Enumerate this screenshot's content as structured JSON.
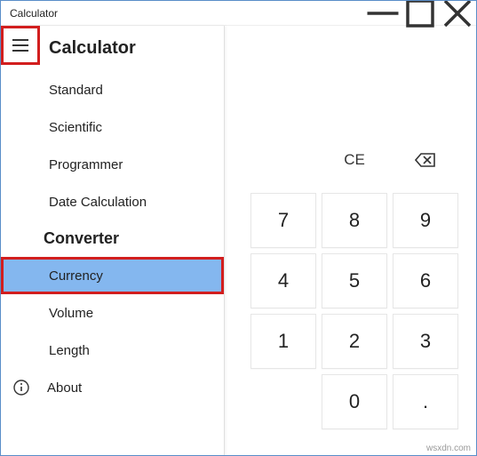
{
  "window": {
    "title": "Calculator"
  },
  "app": {
    "name": "Calculator"
  },
  "menu": {
    "calculator_items": [
      "Standard",
      "Scientific",
      "Programmer",
      "Date Calculation"
    ],
    "converter_header": "Converter",
    "converter_items": [
      "Currency",
      "Volume",
      "Length"
    ],
    "selected": "Currency",
    "about": "About"
  },
  "keypad": {
    "ce": "CE",
    "backspace_icon": "backspace",
    "numbers": [
      "7",
      "8",
      "9",
      "4",
      "5",
      "6",
      "1",
      "2",
      "3"
    ],
    "zero": "0",
    "dot": "."
  },
  "watermark": "wsxdn.com"
}
